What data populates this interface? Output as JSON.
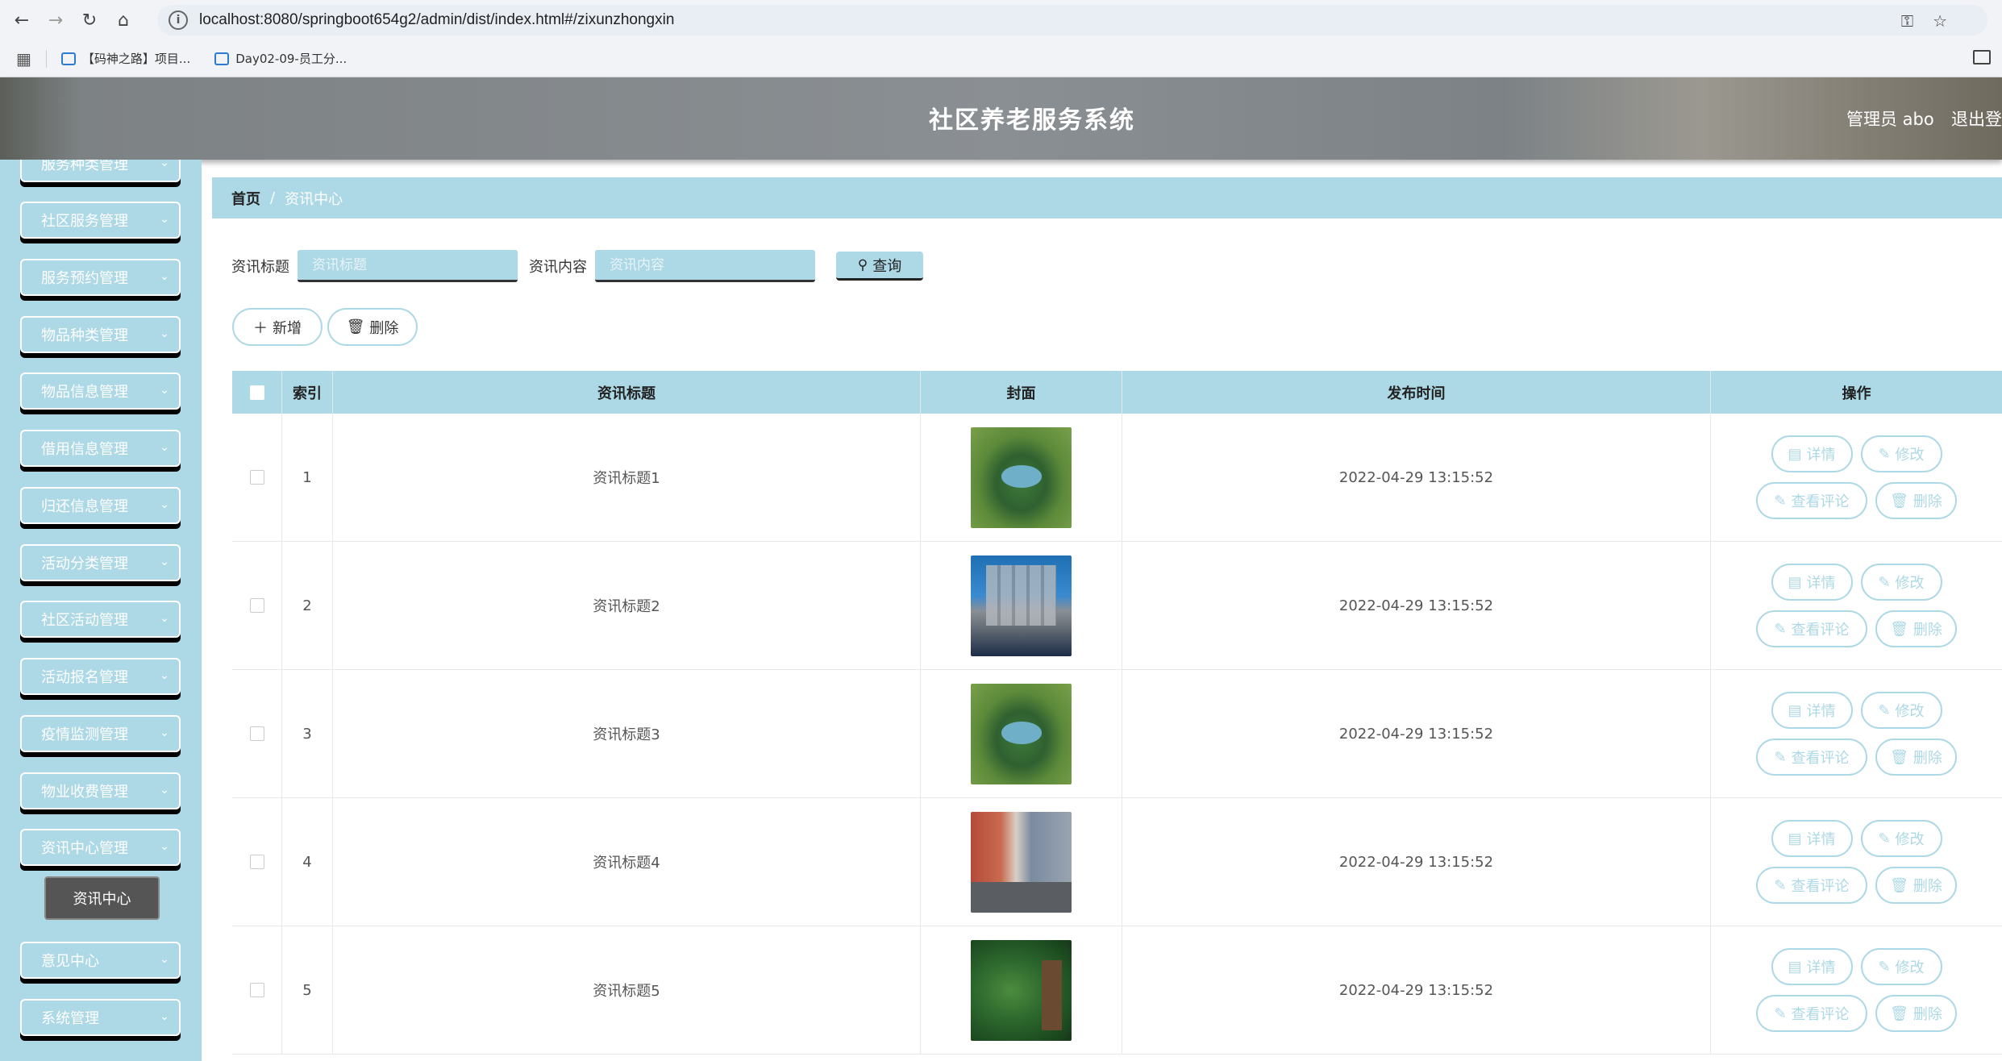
{
  "browser": {
    "url": "localhost:8080/springboot654g2/admin/dist/index.html#/zixunzhongxin",
    "bookmarks": [
      "【码神之路】项目...",
      "Day02-09-员工分..."
    ]
  },
  "header": {
    "title": "社区养老服务系统",
    "user": "管理员 abo",
    "logout": "退出登"
  },
  "sidebar": {
    "items": [
      {
        "label": "服务种类管理"
      },
      {
        "label": "社区服务管理"
      },
      {
        "label": "服务预约管理"
      },
      {
        "label": "物品种类管理"
      },
      {
        "label": "物品信息管理"
      },
      {
        "label": "借用信息管理"
      },
      {
        "label": "归还信息管理"
      },
      {
        "label": "活动分类管理"
      },
      {
        "label": "社区活动管理"
      },
      {
        "label": "活动报名管理"
      },
      {
        "label": "疫情监测管理"
      },
      {
        "label": "物业收费管理"
      },
      {
        "label": "资讯中心管理"
      },
      {
        "label": "意见中心"
      },
      {
        "label": "系统管理"
      }
    ],
    "active_sub": "资讯中心"
  },
  "breadcrumb": {
    "home": "首页",
    "sep": "/",
    "current": "资讯中心"
  },
  "search": {
    "title_label": "资讯标题",
    "title_placeholder": "资讯标题",
    "content_label": "资讯内容",
    "content_placeholder": "资讯内容",
    "button": "查询"
  },
  "actions": {
    "add": "新增",
    "delete": "删除"
  },
  "table": {
    "headers": {
      "index": "索引",
      "title": "资讯标题",
      "cover": "封面",
      "time": "发布时间",
      "ops": "操作"
    },
    "rows": [
      {
        "index": "1",
        "title": "资讯标题1",
        "time": "2022-04-29 13:15:52",
        "cover": "garden"
      },
      {
        "index": "2",
        "title": "资讯标题2",
        "time": "2022-04-29 13:15:52",
        "cover": "tower"
      },
      {
        "index": "3",
        "title": "资讯标题3",
        "time": "2022-04-29 13:15:52",
        "cover": "garden"
      },
      {
        "index": "4",
        "title": "资讯标题4",
        "time": "2022-04-29 13:15:52",
        "cover": "street"
      },
      {
        "index": "5",
        "title": "资讯标题5",
        "time": "2022-04-29 13:15:52",
        "cover": "park"
      }
    ],
    "ops": {
      "detail": "详情",
      "edit": "修改",
      "comments": "查看评论",
      "delete": "删除"
    }
  },
  "colors": {
    "accent": "#add8e6",
    "submenu": "#555555"
  }
}
